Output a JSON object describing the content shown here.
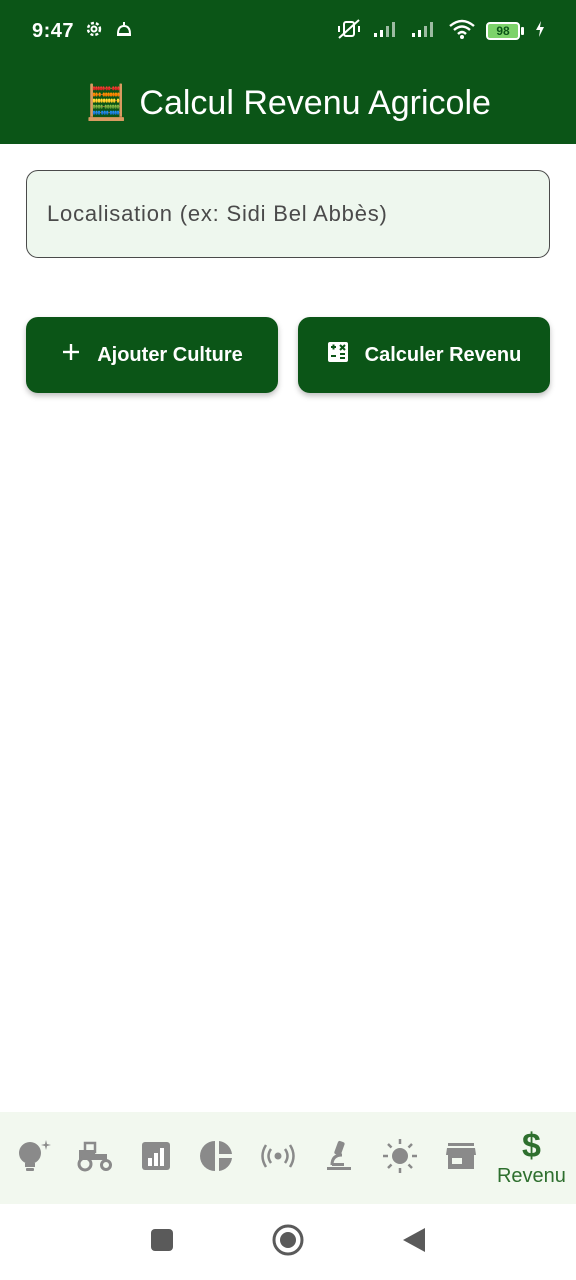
{
  "status_bar": {
    "time": "9:47",
    "battery": "98",
    "icons": [
      "settings-gear-icon",
      "alarm-icon",
      "vibrate-silent-icon",
      "signal-icon",
      "signal-icon",
      "wifi-icon",
      "battery-icon",
      "charging-icon"
    ]
  },
  "app_bar": {
    "emoji": "🧮",
    "title": "Calcul Revenu Agricole",
    "color": "#0b5517"
  },
  "location_field": {
    "placeholder": "Localisation (ex: Sidi Bel Abbès)",
    "value": ""
  },
  "actions": {
    "add_label": "Ajouter Culture",
    "calc_label": "Calculer Revenu"
  },
  "bottom_nav": {
    "items": [
      {
        "icon": "lightbulb-sparkle-icon",
        "label": ""
      },
      {
        "icon": "tractor-icon",
        "label": ""
      },
      {
        "icon": "bar-chart-icon",
        "label": ""
      },
      {
        "icon": "pie-chart-icon",
        "label": ""
      },
      {
        "icon": "sensor-broadcast-icon",
        "label": ""
      },
      {
        "icon": "microscope-icon",
        "label": ""
      },
      {
        "icon": "sun-icon",
        "label": ""
      },
      {
        "icon": "store-icon",
        "label": ""
      },
      {
        "icon": "dollar-icon",
        "label": "Revenu",
        "active": true
      }
    ],
    "active_color": "#2e6f2e",
    "inactive_color": "#8a8a8a"
  },
  "system_nav": {
    "buttons": [
      "recents-square-icon",
      "home-circle-icon",
      "back-triangle-icon"
    ]
  }
}
